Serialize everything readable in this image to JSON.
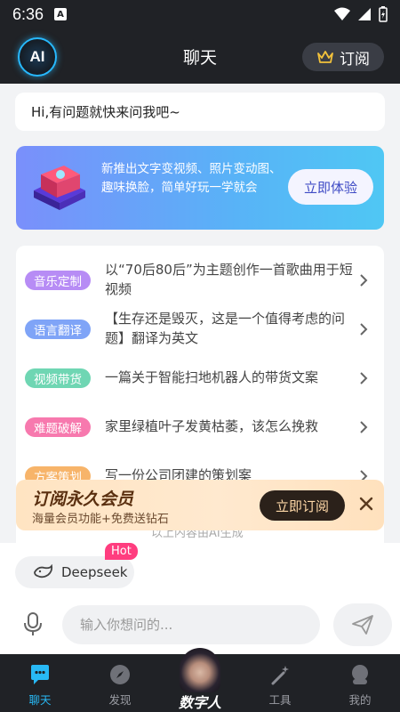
{
  "status_bar": {
    "time": "6:36",
    "a_icon_letter": "A"
  },
  "header": {
    "logo_text": "AI",
    "title": "聊天",
    "subscribe_label": "订阅"
  },
  "greeting": "Hi,有问题就快来问我吧~",
  "banner": {
    "text": "新推出文字变视频、照片变动图、趣味换脸，简单好玩一学就会",
    "button_label": "立即体验"
  },
  "prompts": [
    {
      "tag": "音乐定制",
      "tag_color": "#b78cf5",
      "text": "以“70后80后”为主题创作一首歌曲用于短视频"
    },
    {
      "tag": "语言翻译",
      "tag_color": "#7fa4f7",
      "text": "【生存还是毁灭，这是一个值得考虑的问题】翻译为英文"
    },
    {
      "tag": "视频带货",
      "tag_color": "#6fd6b3",
      "text": "一篇关于智能扫地机器人的带货文案"
    },
    {
      "tag": "难题破解",
      "tag_color": "#f779ae",
      "text": "家里绿植叶子发黄枯萎，该怎么挽救"
    },
    {
      "tag": "方案策划",
      "tag_color": "#f7b46a",
      "text": "写一份公司团建的策划案"
    }
  ],
  "membership": {
    "title": "订阅永久会员",
    "subtitle": "海量会员功能+免费送钻石",
    "button_label": "立即订阅"
  },
  "faded_note": "以上内容由AI生成",
  "model_chip": {
    "label": "Deepseek",
    "badge": "Hot"
  },
  "composer": {
    "placeholder": "输入你想问的..."
  },
  "tabbar": {
    "items": [
      {
        "label": "聊天",
        "active": true
      },
      {
        "label": "发现",
        "active": false
      },
      {
        "label": "数字人",
        "active": false
      },
      {
        "label": "工具",
        "active": false
      },
      {
        "label": "我的",
        "active": false
      }
    ]
  },
  "colors": {
    "accent": "#28b9f5",
    "dark_bar": "#202226",
    "hot_badge": "#ff3d7f"
  }
}
